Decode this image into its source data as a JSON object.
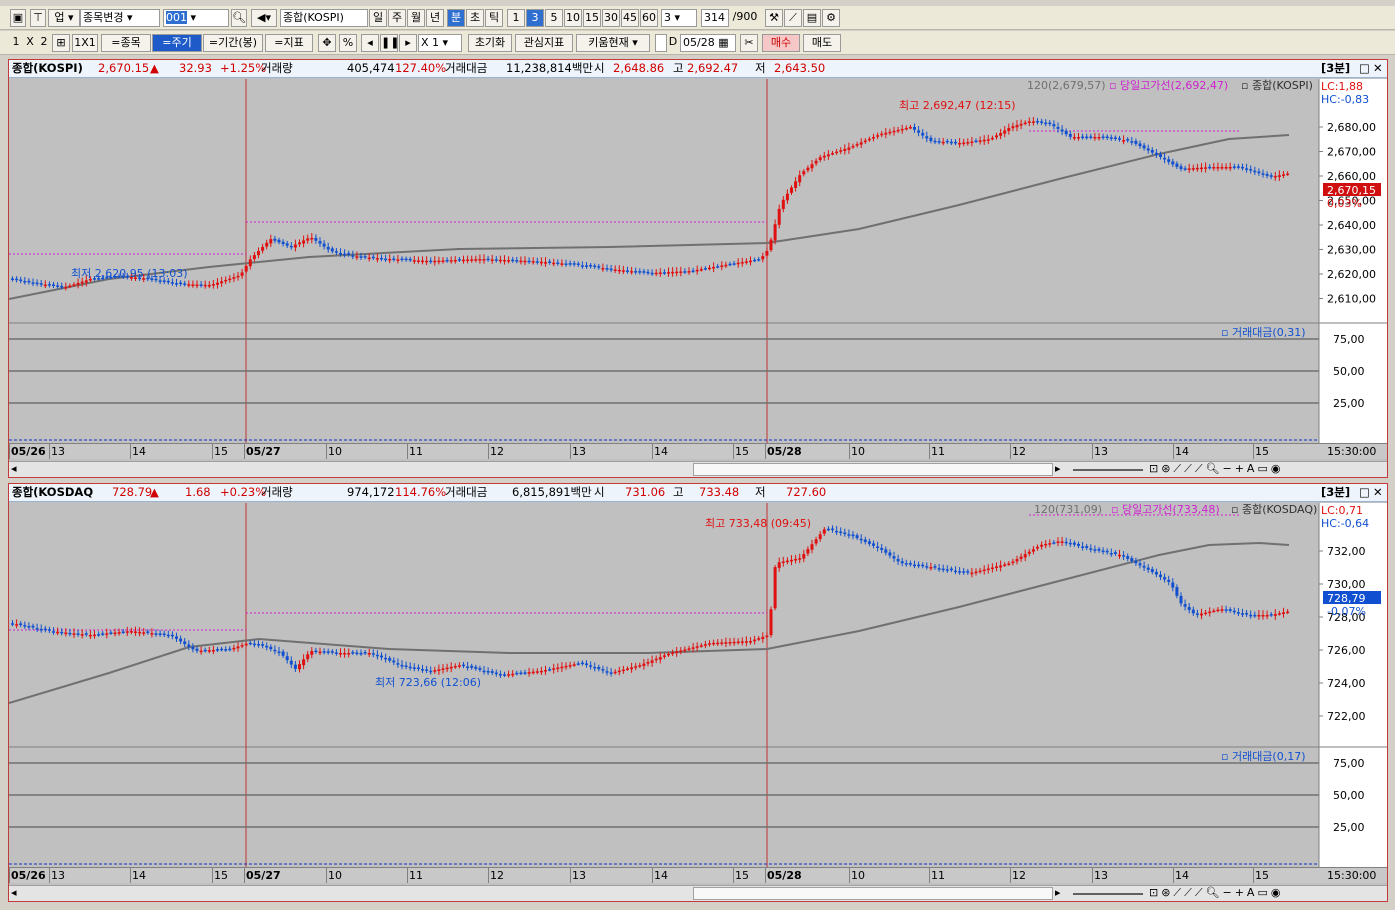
{
  "toolbar1": {
    "market_select": "업",
    "stock_change": "종목변경",
    "code": "001",
    "index_name": "종합(KOSPI)",
    "periods": [
      "일",
      "주",
      "월",
      "년",
      "분",
      "초",
      "틱"
    ],
    "active_period": "분",
    "intervals": [
      "1",
      "3",
      "5",
      "10",
      "15",
      "30",
      "45",
      "60"
    ],
    "active_interval": "3",
    "interval_value": "3",
    "count": "314",
    "count_max": "/900"
  },
  "toolbar2": {
    "layout_1": "1",
    "layout_x": "X",
    "layout_2": "2",
    "layout_1x1": "1X1",
    "by_stock": "=종목",
    "by_period": "=주기",
    "by_range": "=기간(봉)",
    "by_indicator": "=지표",
    "percent": "%",
    "multiplier": "X 1",
    "reset": "초기화",
    "watch": "관심지표",
    "kiwoom_now": "키움현재",
    "date": "05/28",
    "buy": "매수",
    "sell": "매도"
  },
  "panels": [
    {
      "name": "종합(KOSPI)",
      "price": "2,670.15",
      "arrow": "▲",
      "change": "32.93",
      "pct": "+1.25%",
      "vol_label": "거래량",
      "vol": "405,474",
      "vol_pct": "127.40%",
      "amt_label": "거래대금",
      "amt": "11,238,814백만",
      "open_label": "시",
      "open": "2,648.86",
      "high_label": "고",
      "high": "2,692.47",
      "low_label": "저",
      "low": "2,643.50",
      "period": "[3분]",
      "y_ticks": [
        "2,680,00",
        "2,670,00",
        "2,660,00",
        "2,650,00",
        "2,640,00",
        "2,630,00",
        "2,620,00",
        "2,610,00"
      ],
      "lc": "LC:1,88",
      "hc": "HC:-0,83",
      "cur_tag": "2,670,15",
      "cur_pct": "0,03%",
      "ma_label": "120(2,679,57)",
      "today_high_line": "당일고가선(2,692,47)",
      "series_label": "종합(KOSPI)",
      "max_label": "최고 2,692,47 (12:15)",
      "min_label": "최저 2,620,95 (13:03)",
      "sub_label": "거래대금(0,31)",
      "sub_ticks": [
        "75,00",
        "50,00",
        "25,00"
      ],
      "x_labels": [
        "05/26",
        "13",
        "14",
        "15",
        "05/27",
        "10",
        "11",
        "12",
        "13",
        "14",
        "15",
        "05/28",
        "10",
        "11",
        "12",
        "13",
        "14",
        "15"
      ],
      "x_time": "15:30:00"
    },
    {
      "name": "종합(KOSDAQ",
      "price": "728.79",
      "arrow": "▲",
      "change": "1.68",
      "pct": "+0.23%",
      "vol_label": "거래량",
      "vol": "974,172",
      "vol_pct": "114.76%",
      "amt_label": "거래대금",
      "amt": "6,815,891백만",
      "open_label": "시",
      "open": "731.06",
      "high_label": "고",
      "high": "733.48",
      "low_label": "저",
      "low": "727.60",
      "period": "[3분]",
      "y_ticks": [
        "732,00",
        "730,00",
        "728,00",
        "726,00",
        "724,00",
        "722,00"
      ],
      "lc": "LC:0,71",
      "hc": "HC:-0,64",
      "cur_tag": "728,79",
      "cur_pct": "-0,07%",
      "ma_label": "120(731,09)",
      "today_high_line": "당일고가선(733,48)",
      "series_label": "종합(KOSDAQ)",
      "max_label": "최고 733,48 (09:45)",
      "min_label": "최저 723,66 (12:06)",
      "sub_label": "거래대금(0,17)",
      "sub_ticks": [
        "75,00",
        "50,00",
        "25,00"
      ],
      "x_labels": [
        "05/26",
        "13",
        "14",
        "15",
        "05/27",
        "10",
        "11",
        "12",
        "13",
        "14",
        "15",
        "05/28",
        "10",
        "11",
        "12",
        "13",
        "14",
        "15"
      ],
      "x_time": "15:30:00"
    }
  ],
  "colors": {
    "up": "#e01010",
    "down": "#1050d0",
    "ma": "#707070",
    "hiline": "#d020d0",
    "grid": "#808080"
  }
}
